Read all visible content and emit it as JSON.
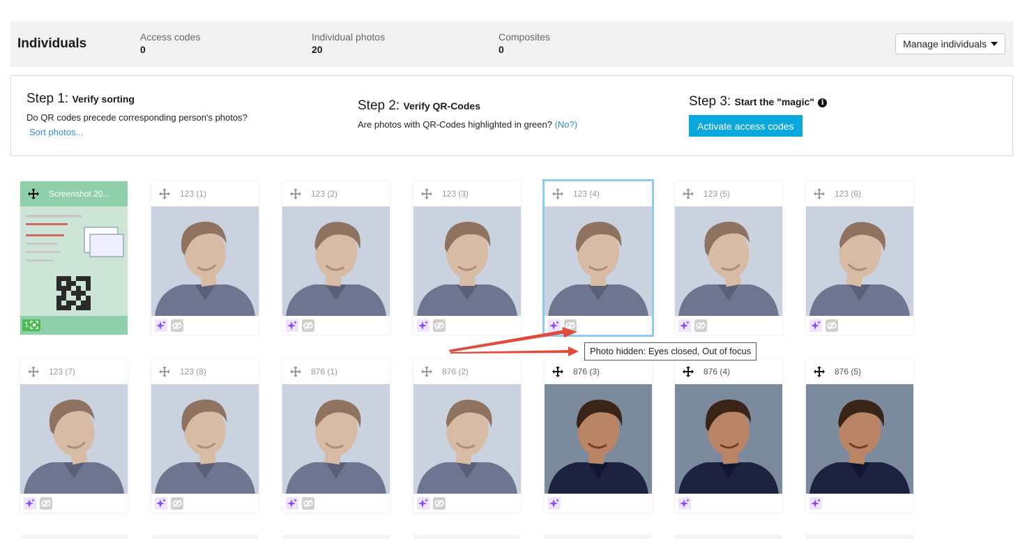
{
  "stats": {
    "title": "Individuals",
    "access_codes_label": "Access codes",
    "access_codes_value": "0",
    "individual_photos_label": "Individual photos",
    "individual_photos_value": "20",
    "composites_label": "Composites",
    "composites_value": "0",
    "manage_label": "Manage individuals"
  },
  "steps": {
    "step1_prefix": "Step 1: ",
    "step1_title": "Verify sorting",
    "step1_desc": "Do QR codes precede corresponding person's photos?",
    "step1_link": "Sort photos...",
    "step2_prefix": "Step 2: ",
    "step2_title": "Verify QR-Codes",
    "step2_desc": "Are photos with QR-Codes highlighted in green?",
    "step2_link": "(No?)",
    "step3_prefix": "Step 3: ",
    "step3_title": "Start the \"magic\"",
    "step3_button": "Activate access codes"
  },
  "cards": [
    {
      "name": "Screenshot 20...",
      "type": "qr",
      "badge": "1"
    },
    {
      "name": "123 (1)",
      "type": "hidden"
    },
    {
      "name": "123 (2)",
      "type": "hidden"
    },
    {
      "name": "123 (3)",
      "type": "hidden"
    },
    {
      "name": "123 (4)",
      "type": "hidden",
      "selected": true
    },
    {
      "name": "123 (5)",
      "type": "hidden"
    },
    {
      "name": "123 (6)",
      "type": "hidden"
    },
    {
      "name": "123 (7)",
      "type": "hidden"
    },
    {
      "name": "123 (8)",
      "type": "hidden"
    },
    {
      "name": "876 (1)",
      "type": "hidden"
    },
    {
      "name": "876 (2)",
      "type": "hidden"
    },
    {
      "name": "876 (3)",
      "type": "visible"
    },
    {
      "name": "876 (4)",
      "type": "visible"
    },
    {
      "name": "876 (5)",
      "type": "visible"
    }
  ],
  "tooltip": "Photo hidden: Eyes closed, Out of focus",
  "colors": {
    "accent": "#0ba8e0",
    "qr_green": "#8fcfac",
    "selected_border": "#8fcbee",
    "link": "#2e8bd8"
  }
}
